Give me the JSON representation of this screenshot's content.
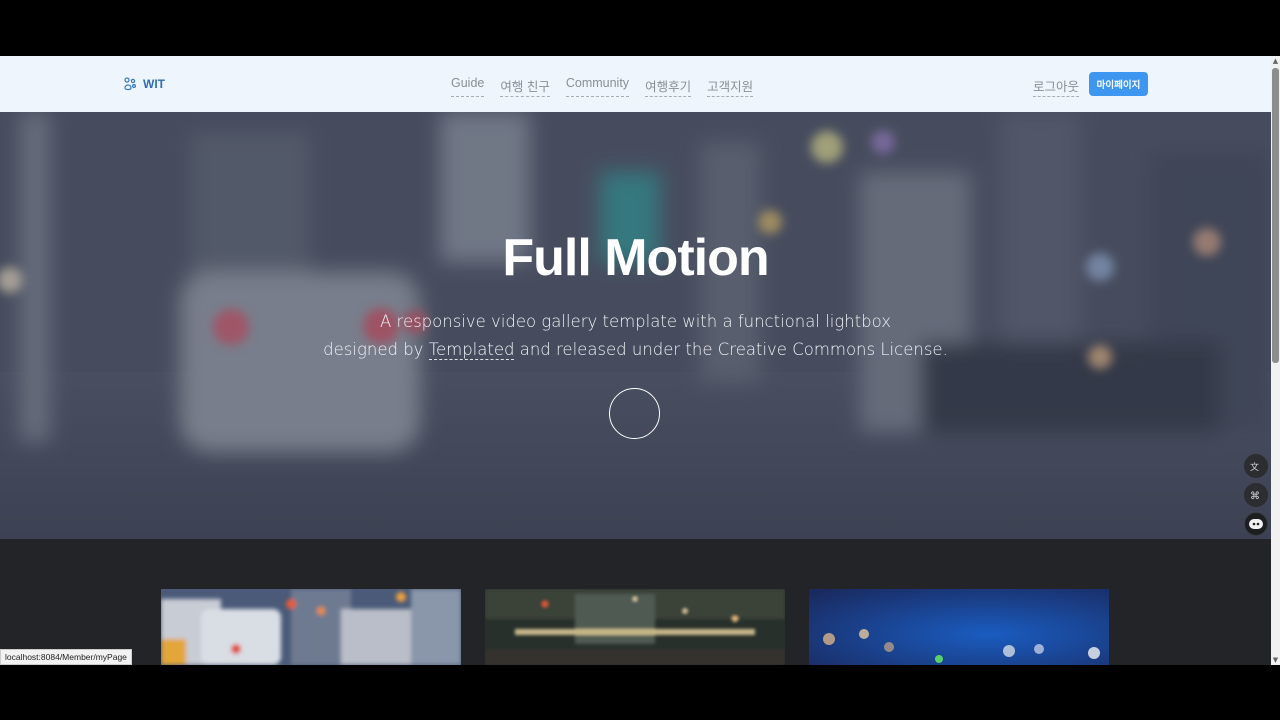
{
  "header": {
    "logo_text": "WIT",
    "nav": [
      "Guide",
      "여행 친구",
      "Community",
      "여행후기",
      "고객지원"
    ],
    "logout_label": "로그아웃",
    "mypage_label": "마이페이지"
  },
  "hero": {
    "title": "Full Motion",
    "subtitle_line1": "A responsive video gallery template with a functional lightbox",
    "subtitle_pre": "designed by",
    "subtitle_link": "Templated",
    "subtitle_post": "and released under the Creative Commons License."
  },
  "floating": {
    "translate_icon": "translate-icon",
    "command_icon": "command-icon",
    "assistant_icon": "assistant-icon"
  },
  "gallery": {
    "items": [
      "city-traffic-thumbnail",
      "night-city-thumbnail",
      "bokeh-lights-thumbnail"
    ]
  },
  "status_bar": {
    "url": "localhost:8084/Member/myPage"
  },
  "colors": {
    "header_bg": "#eef5fc",
    "accent": "#3d96f0",
    "logo": "#2f6db5",
    "page_bg": "#232427"
  }
}
